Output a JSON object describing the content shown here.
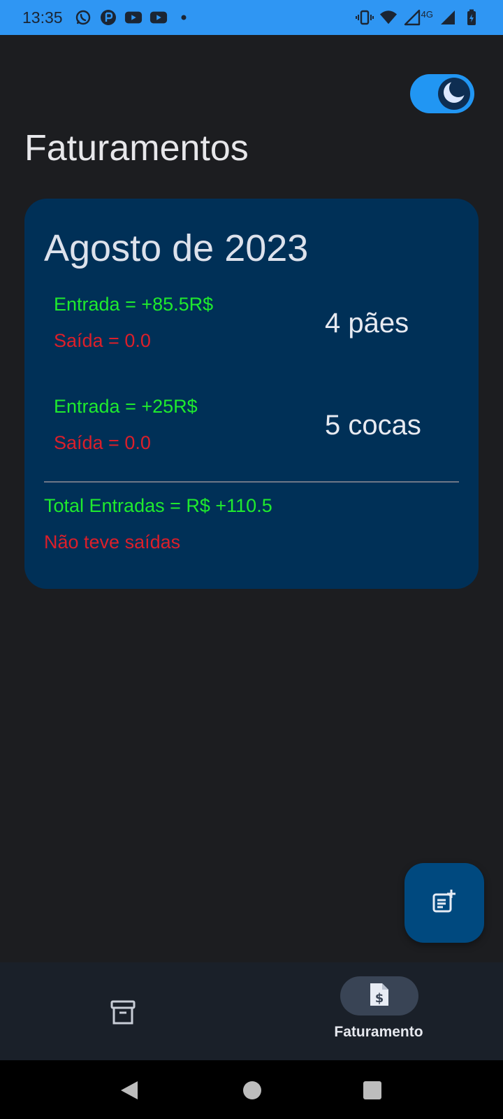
{
  "status_bar": {
    "time": "13:35",
    "left_icons": [
      "whatsapp-icon",
      "app-icon",
      "youtube-icon",
      "youtube-icon",
      "dot-icon"
    ],
    "right_icons": [
      "vibrate-icon",
      "wifi-icon",
      "signal-icon",
      "network-4g",
      "signal-icon",
      "battery-icon"
    ],
    "network_label": "4G",
    "background_color": "#2f96f3"
  },
  "header": {
    "title": "Faturamentos",
    "theme_toggle": {
      "state": "dark",
      "icon": "moon-icon",
      "on": true
    }
  },
  "card": {
    "month": "Agosto de 2023",
    "entries": [
      {
        "entrada": "Entrada = +85.5R$",
        "saida": "Saída = 0.0",
        "quantity": "4 pães"
      },
      {
        "entrada": "Entrada = +25R$",
        "saida": "Saída = 0.0",
        "quantity": "5 cocas"
      }
    ],
    "total_entradas": "Total Entradas = R$ +110.5",
    "total_saidas": "Não teve saídas",
    "background_color": "#003057"
  },
  "fab": {
    "icon": "add-note-icon"
  },
  "bottom_nav": {
    "items": [
      {
        "icon": "archive-icon",
        "label": "",
        "active": false
      },
      {
        "icon": "invoice-dollar-icon",
        "label": "Faturamento",
        "active": true
      }
    ]
  },
  "system_nav": {
    "buttons": [
      "back-icon",
      "home-icon",
      "recents-icon"
    ]
  },
  "colors": {
    "income": "#1fea2e",
    "expense": "#dc1f2a",
    "background": "#1c1d20",
    "accent": "#2196f3"
  }
}
